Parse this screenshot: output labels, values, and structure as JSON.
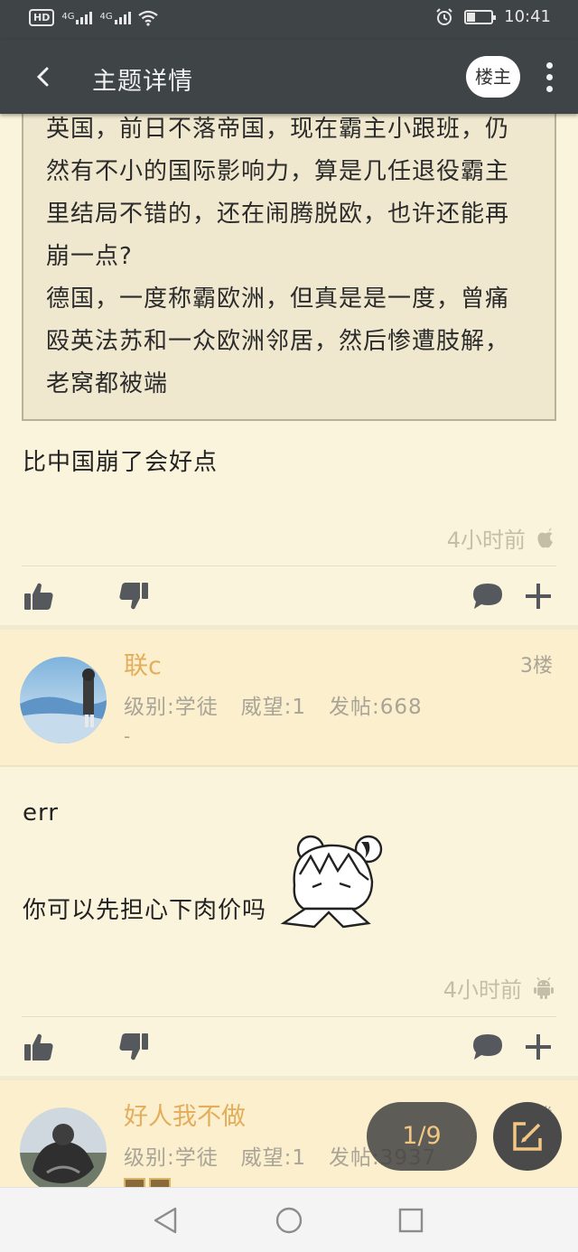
{
  "status_bar": {
    "left_chip": "HD",
    "signal_1": "4G",
    "signal_2": "4G",
    "time": "10:41",
    "battery_level": 0.35
  },
  "header": {
    "title": "主题详情",
    "op_button": "楼主"
  },
  "post2": {
    "quote": "英国，前日不落帝国，现在霸主小跟班，仍\n然有不小的国际影响力，算是几任退役霸主\n里结局不错的，还在闹腾脱欧，也许还能再\n崩一点?\n德国，一度称霸欧洲，但真是是一度，曾痛\n殴英法苏和一众欧洲邻居，然后惨遭肢解，\n老窝都被端",
    "body": "比中国崩了会好点",
    "time": "4小时前",
    "device_icon": "apple-icon"
  },
  "post3": {
    "username": "联c",
    "info": "级别:学徒   威望:1   发帖:668",
    "floor": "3楼",
    "signature": "-",
    "line1": "err",
    "line2": "你可以先担心下肉价吗",
    "time": "4小时前",
    "device_icon": "android-icon"
  },
  "post4": {
    "username": "好人我不做",
    "info": "级别:学徒   威望:1   发帖:3937",
    "floor": "4楼"
  },
  "pagination": {
    "label": "1/9"
  },
  "colors": {
    "header_bg": "#3f4447",
    "page_bg": "#fbf4dc",
    "username": "#e3ad5c",
    "page_indicator_text": "#f3c681"
  }
}
